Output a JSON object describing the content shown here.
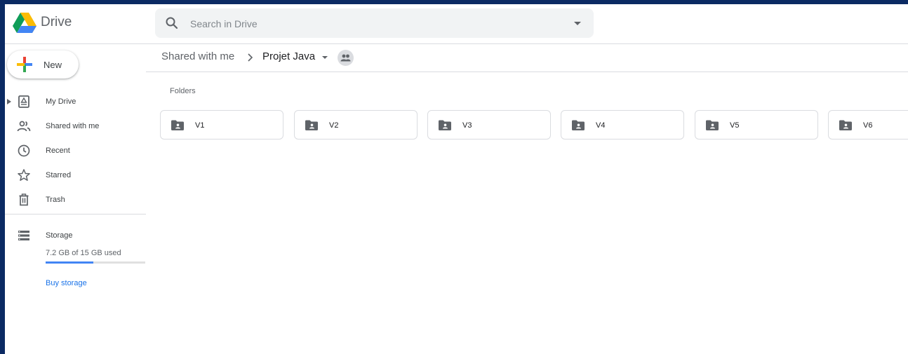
{
  "app": {
    "title": "Drive"
  },
  "search": {
    "placeholder": "Search in Drive"
  },
  "sidebar": {
    "new_label": "New",
    "items": [
      {
        "label": "My Drive",
        "icon": "my-drive-icon"
      },
      {
        "label": "Shared with me",
        "icon": "shared-icon"
      },
      {
        "label": "Recent",
        "icon": "clock-icon"
      },
      {
        "label": "Starred",
        "icon": "star-icon"
      },
      {
        "label": "Trash",
        "icon": "trash-icon"
      }
    ],
    "storage": {
      "label": "Storage",
      "used_text": "7.2 GB of 15 GB used",
      "used_fraction": 0.48,
      "buy_label": "Buy storage"
    }
  },
  "breadcrumb": {
    "parent": "Shared with me",
    "current": "Projet Java"
  },
  "main": {
    "folders_title": "Folders",
    "folders": [
      {
        "name": "V1"
      },
      {
        "name": "V2"
      },
      {
        "name": "V3"
      },
      {
        "name": "V4"
      },
      {
        "name": "V5"
      },
      {
        "name": "V6"
      }
    ]
  },
  "colors": {
    "accent": "#1a73e8",
    "storage_fill": "#4285f4",
    "desktop_background": "#0b2a63"
  }
}
